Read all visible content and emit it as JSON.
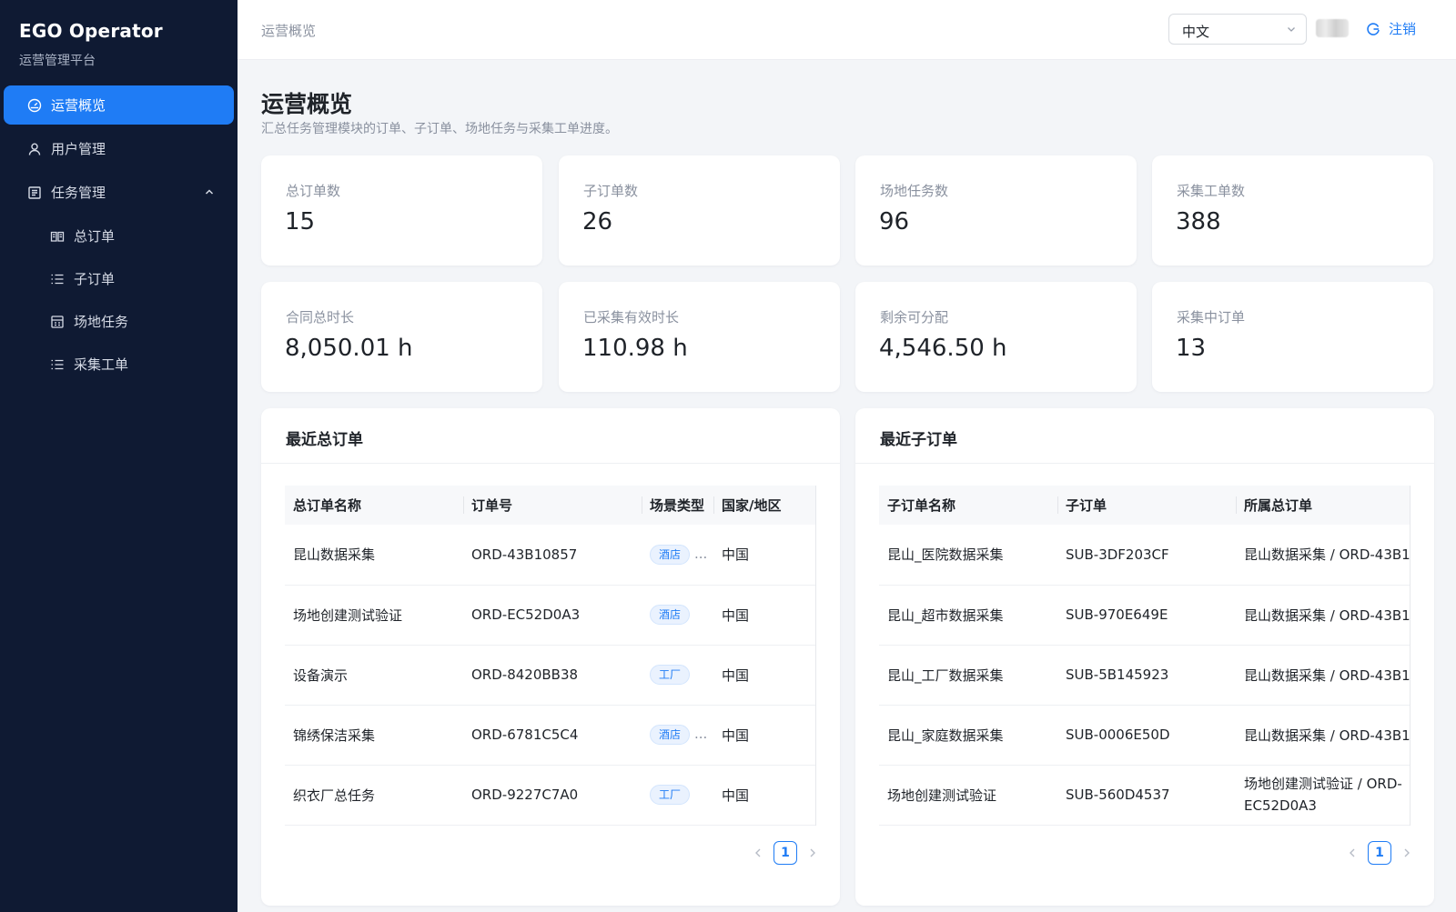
{
  "brand": {
    "title": "EGO Operator",
    "subtitle": "运营管理平台"
  },
  "sidebar": {
    "items": [
      {
        "label": "运营概览",
        "icon": "dashboard-icon",
        "active": true
      },
      {
        "label": "用户管理",
        "icon": "user-icon"
      },
      {
        "label": "任务管理",
        "icon": "task-icon",
        "expanded": true
      }
    ],
    "subitems": [
      {
        "label": "总订单",
        "icon": "book-icon"
      },
      {
        "label": "子订单",
        "icon": "list-icon"
      },
      {
        "label": "场地任务",
        "icon": "building-icon"
      },
      {
        "label": "采集工单",
        "icon": "list-icon"
      }
    ]
  },
  "header": {
    "breadcrumb": "运营概览",
    "language": "中文",
    "logout_label": "注销"
  },
  "page": {
    "title": "运营概览",
    "description": "汇总任务管理模块的订单、子订单、场地任务与采集工单进度。"
  },
  "stats": [
    {
      "label": "总订单数",
      "value": "15"
    },
    {
      "label": "子订单数",
      "value": "26"
    },
    {
      "label": "场地任务数",
      "value": "96"
    },
    {
      "label": "采集工单数",
      "value": "388"
    },
    {
      "label": "合同总时长",
      "value": "8,050.01 h"
    },
    {
      "label": "已采集有效时长",
      "value": "110.98 h"
    },
    {
      "label": "剩余可分配",
      "value": "4,546.50 h"
    },
    {
      "label": "采集中订单",
      "value": "13"
    }
  ],
  "recent_orders": {
    "title": "最近总订单",
    "columns": [
      "总订单名称",
      "订单号",
      "场景类型",
      "国家/地区"
    ],
    "rows": [
      {
        "name": "昆山数据采集",
        "id": "ORD-43B10857",
        "scene": "酒店",
        "more": "...",
        "country": "中国"
      },
      {
        "name": "场地创建测试验证",
        "id": "ORD-EC52D0A3",
        "scene": "酒店",
        "more": "",
        "country": "中国"
      },
      {
        "name": "设备演示",
        "id": "ORD-8420BB38",
        "scene": "工厂",
        "more": "",
        "country": "中国"
      },
      {
        "name": "锦绣保洁采集",
        "id": "ORD-6781C5C4",
        "scene": "酒店",
        "more": "...",
        "country": "中国"
      },
      {
        "name": "织衣厂总任务",
        "id": "ORD-9227C7A0",
        "scene": "工厂",
        "more": "",
        "country": "中国"
      }
    ],
    "page": "1"
  },
  "recent_suborders": {
    "title": "最近子订单",
    "columns": [
      "子订单名称",
      "子订单",
      "所属总订单"
    ],
    "rows": [
      {
        "name": "昆山_医院数据采集",
        "id": "SUB-3DF203CF",
        "parent": "昆山数据采集 / ORD-43B1("
      },
      {
        "name": "昆山_超市数据采集",
        "id": "SUB-970E649E",
        "parent": "昆山数据采集 / ORD-43B1("
      },
      {
        "name": "昆山_工厂数据采集",
        "id": "SUB-5B145923",
        "parent": "昆山数据采集 / ORD-43B1("
      },
      {
        "name": "昆山_家庭数据采集",
        "id": "SUB-0006E50D",
        "parent": "昆山数据采集 / ORD-43B1("
      },
      {
        "name": "场地创建测试验证",
        "id": "SUB-560D4537",
        "parent": "场地创建测试验证 / ORD-EC52D0A3"
      }
    ],
    "page": "1"
  },
  "colors": {
    "sidebar_bg": "#0f1a33",
    "accent": "#1f7cf5",
    "page_bg": "#f3f5f8"
  }
}
